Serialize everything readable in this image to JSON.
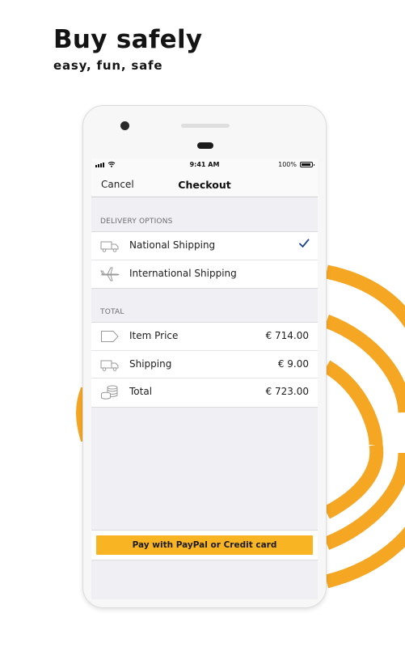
{
  "promo": {
    "headline": "Buy safely",
    "subline": "easy, fun, safe"
  },
  "colors": {
    "accent": "#f5a623",
    "button": "#f9b424",
    "check": "#1d3f8f"
  },
  "statusbar": {
    "time": "9:41 AM",
    "battery": "100%"
  },
  "nav": {
    "cancel": "Cancel",
    "title": "Checkout"
  },
  "delivery": {
    "header": "DELIVERY OPTIONS",
    "options": [
      {
        "label": "National Shipping",
        "icon": "truck-icon",
        "selected": true
      },
      {
        "label": "International Shipping",
        "icon": "airplane-icon",
        "selected": false
      }
    ]
  },
  "total": {
    "header": "TOTAL",
    "rows": [
      {
        "label": "Item Price",
        "value": "€ 714.00",
        "icon": "price-tag-icon"
      },
      {
        "label": "Shipping",
        "value": "€ 9.00",
        "icon": "truck-icon"
      },
      {
        "label": "Total",
        "value": "€ 723.00",
        "icon": "coins-icon"
      }
    ]
  },
  "pay": {
    "label": "Pay with PayPal or Credit card"
  }
}
